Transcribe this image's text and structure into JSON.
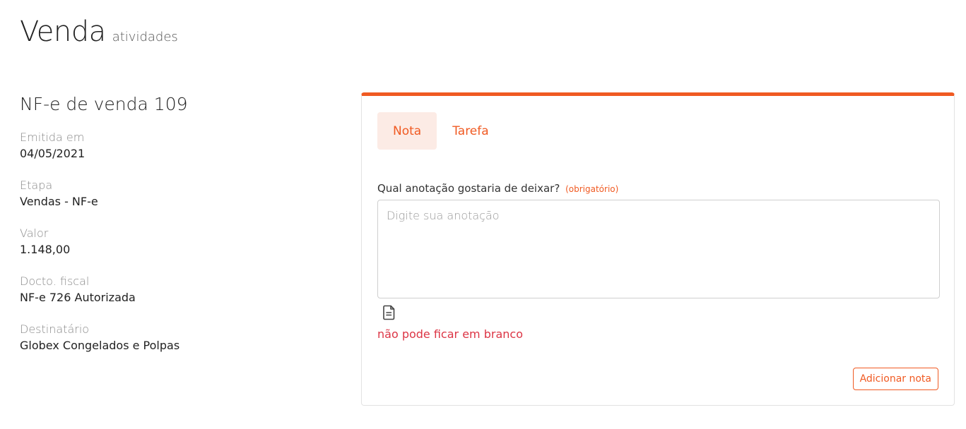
{
  "header": {
    "title": "Venda",
    "subtitle": "atividades"
  },
  "document": {
    "title": "NF-e de venda 109",
    "fields": [
      {
        "label": "Emitida em",
        "value": "04/05/2021"
      },
      {
        "label": "Etapa",
        "value": "Vendas - NF-e"
      },
      {
        "label": "Valor",
        "value": "1.148,00"
      },
      {
        "label": "Docto. fiscal",
        "value": "NF-e 726 Autorizada"
      },
      {
        "label": "Destinatário",
        "value": "Globex Congelados e Polpas"
      }
    ]
  },
  "activity_panel": {
    "accent_color": "#f05a22",
    "tabs": [
      {
        "label": "Nota",
        "active": true
      },
      {
        "label": "Tarefa",
        "active": false
      }
    ],
    "note_form": {
      "question": "Qual anotação gostaria de deixar?",
      "required_hint": "(obrigatório)",
      "input_value": "",
      "input_placeholder": "Digite sua anotação",
      "attach_icon": "document-icon",
      "error_message": "não pode ficar em branco",
      "error_color": "#dc3545",
      "submit_label": "Adicionar nota"
    }
  }
}
